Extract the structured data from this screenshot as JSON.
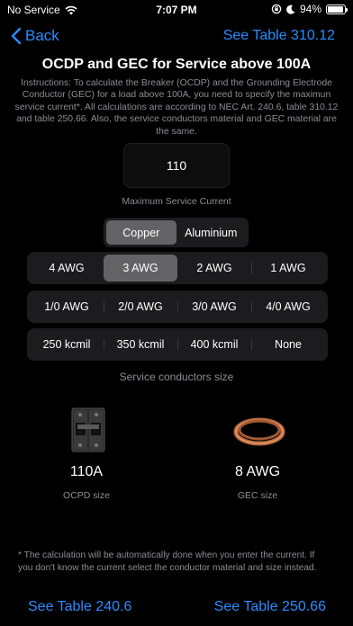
{
  "status_bar": {
    "carrier": "No Service",
    "time": "7:07 PM",
    "battery": "94%",
    "battery_level": 0.94,
    "icons": [
      "wifi-icon",
      "lock-rotation-icon",
      "moon-icon",
      "battery-icon"
    ]
  },
  "nav": {
    "back_label": "Back",
    "right_link": "See Table 310.12"
  },
  "title": "OCDP and GEC for Service above 100A",
  "instructions": "Instructions: To calculate the Breaker (OCDP) and the Grounding Electrode Conductor (GEC) for a load above 100A, you need to specify the maximun service current*. All calculations are according to NEC Art. 240.6, table 310.12  and table 250.66. Also, the service conductors material and GEC material are the same.",
  "current_input": {
    "value": "110",
    "label": "Maximum Service Current"
  },
  "material": {
    "options": [
      "Copper",
      "Aluminium"
    ],
    "selected": "Copper"
  },
  "sizes": {
    "rows": [
      [
        "4 AWG",
        "3 AWG",
        "2 AWG",
        "1 AWG"
      ],
      [
        "1/0 AWG",
        "2/0 AWG",
        "3/0 AWG",
        "4/0 AWG"
      ],
      [
        "250 kcmil",
        "350 kcmil",
        "400 kcmil",
        "None"
      ]
    ],
    "selected": "3 AWG",
    "label": "Service conductors size"
  },
  "results": {
    "ocpd_value": "110A",
    "ocpd_label": "OCPD size",
    "gec_value": "8 AWG",
    "gec_label": "GEC size"
  },
  "footnote": "* The calculation will be automatically done when you enter the current. If you don't know the current select the conductor material and size instead.",
  "bottom_links": {
    "left": "See Table 240.6",
    "right": "See Table 250.66"
  },
  "colors": {
    "accent": "#2a8cff",
    "background": "#000000",
    "secondary_text": "#8e8e93",
    "segment_bg": "#1c1c1e",
    "segment_active": "#636366"
  }
}
